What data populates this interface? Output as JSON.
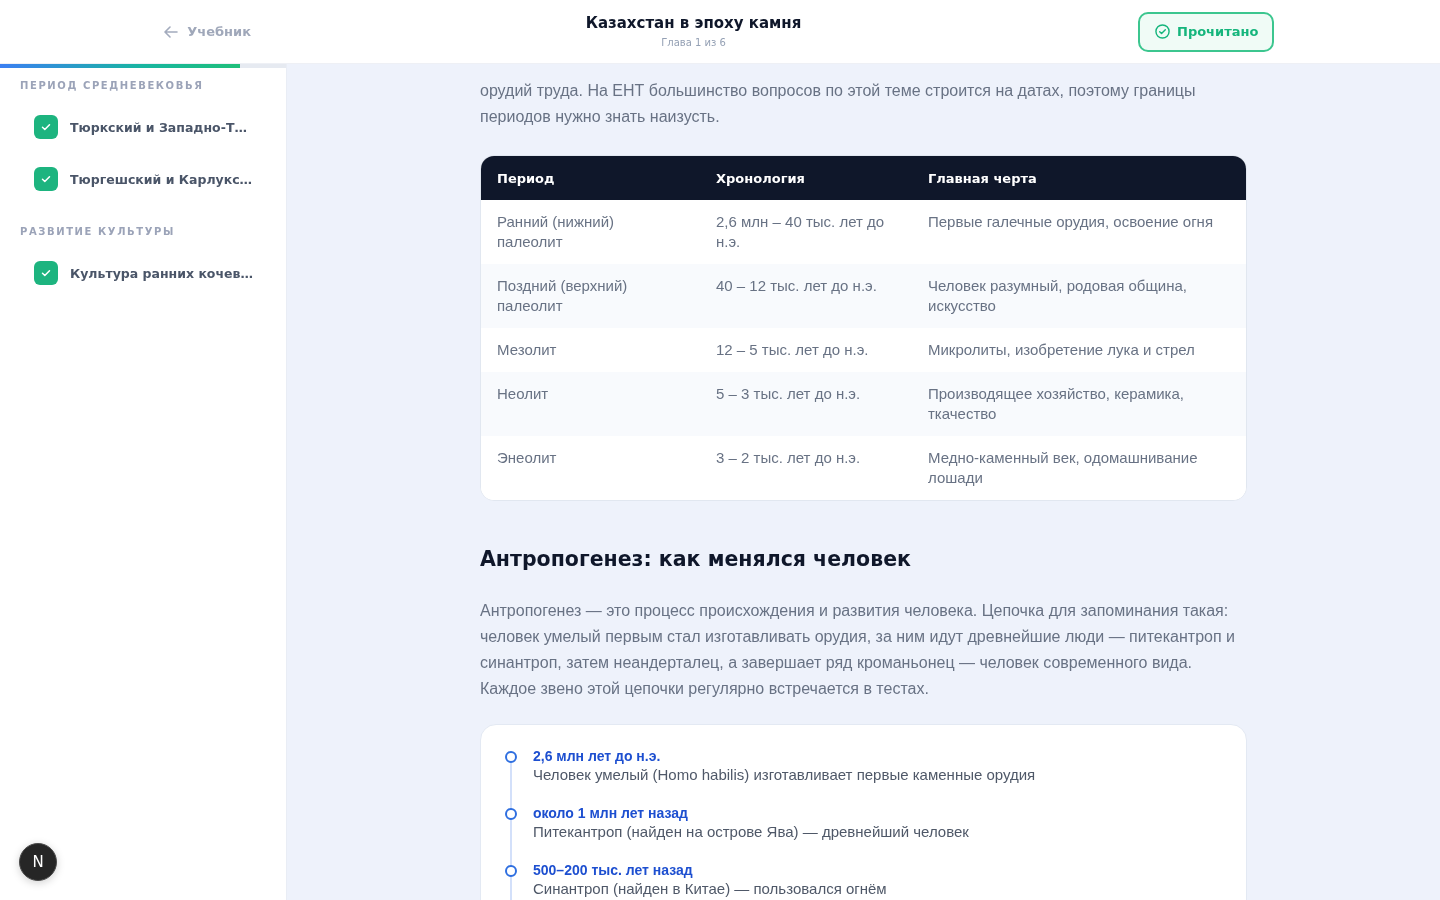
{
  "header": {
    "back_link": "Учебник",
    "title": "Казахстан в эпоху камня",
    "subtitle": "Глава 1 из 6",
    "read_button": "Прочитано"
  },
  "progress": {
    "level": 0.84
  },
  "sidebar": {
    "sections": [
      {
        "title": "ПЕРИОД СРЕДНЕВЕКОВЬЯ",
        "items": [
          {
            "label": "Тюркский и Западно-Т…",
            "checked": true
          },
          {
            "label": "Тюргешский и Карлукс…",
            "checked": true
          }
        ]
      },
      {
        "title": "РАЗВИТИЕ КУЛЬТУРЫ",
        "items": [
          {
            "label": "Культура ранних кочев…",
            "checked": true
          }
        ]
      }
    ]
  },
  "article": {
    "intro": "орудий труда. На ЕНТ большинство вопросов по этой теме строится на датах, поэтому границы периодов нужно знать наизусть.",
    "table": {
      "columns": [
        "Период",
        "Хронология",
        "Главная черта"
      ],
      "rows": [
        [
          "Ранний (нижний) палеолит",
          "2,6 млн – 40 тыс. лет до н.э.",
          "Первые галечные орудия, освоение огня"
        ],
        [
          "Поздний (верхний) палеолит",
          "40 – 12 тыс. лет до н.э.",
          "Человек разумный, родовая община, искусство"
        ],
        [
          "Мезолит",
          "12 – 5 тыс. лет до н.э.",
          "Микролиты, изобретение лука и стрел"
        ],
        [
          "Неолит",
          "5 – 3 тыс. лет до н.э.",
          "Производящее хозяйство, керамика, ткачество"
        ],
        [
          "Энеолит",
          "3 – 2 тыс. лет до н.э.",
          "Медно-каменный век, одомашнивание лошади"
        ]
      ]
    },
    "heading": "Антропогенез: как менялся человек",
    "paragraph": "Антропогенез — это процесс происхождения и развития человека. Цепочка для запоминания такая: человек умелый первым стал изготавливать орудия, за ним идут древнейшие люди — питекантроп и синантроп, затем неандерталец, а завершает ряд кроманьонец — человек современного вида. Каждое звено этой цепочки регулярно встречается в тестах.",
    "timeline": [
      {
        "date": "2,6 млн лет до н.э.",
        "text": "Человек умелый (Homo habilis) изготавливает первые каменные орудия"
      },
      {
        "date": "около 1 млн лет назад",
        "text": "Питекантроп (найден на острове Ява) — древнейший человек"
      },
      {
        "date": "500–200 тыс. лет назад",
        "text": "Синантроп (найден в Китае) — пользовался огнём"
      }
    ]
  },
  "dev_badge": "N"
}
